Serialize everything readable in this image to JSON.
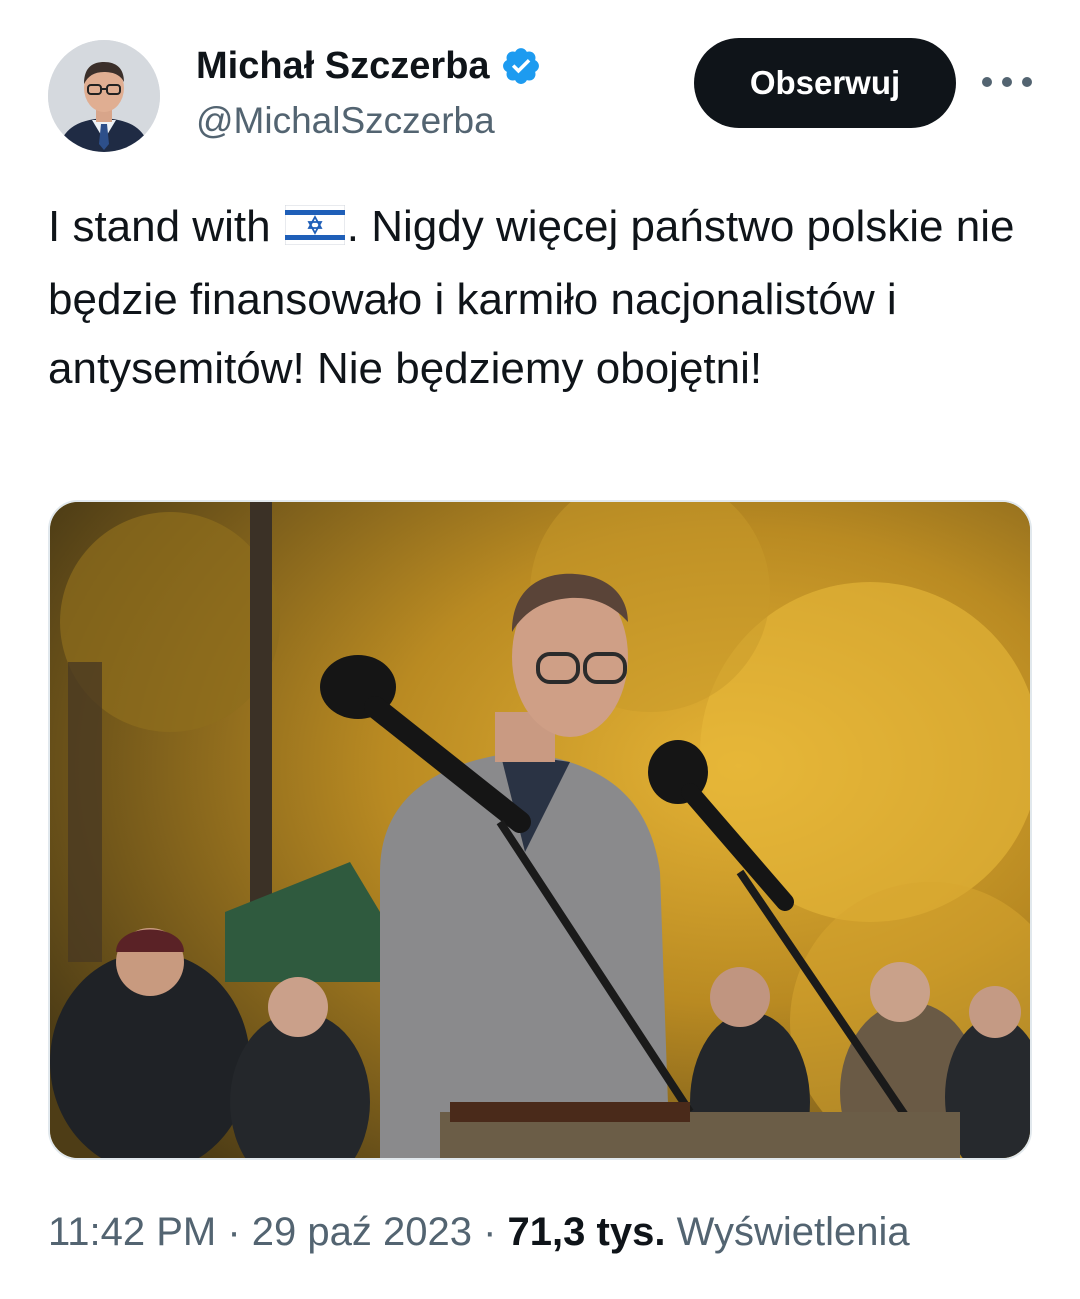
{
  "author": {
    "display_name": "Michał Szczerba",
    "handle": "@MichalSzczerba",
    "verified": true
  },
  "follow_button_label": "Obserwuj",
  "tweet": {
    "text_part1": "I stand with ",
    "flag": "israel-flag-emoji",
    "text_part2": ". Nigdy więcej państwo polskie nie będzie finansowało i karmiło nacjonalistów i antysemitów! Nie będziemy obojętni!"
  },
  "meta": {
    "time": "11:42 PM",
    "separator": " · ",
    "date": "29 paź 2023",
    "views_count": "71,3 tys.",
    "views_label": "Wyświetlenia"
  },
  "colors": {
    "verified_blue": "#1d9bf0",
    "text": "#0f1419",
    "secondary": "#536471",
    "button_bg": "#0f1419"
  }
}
